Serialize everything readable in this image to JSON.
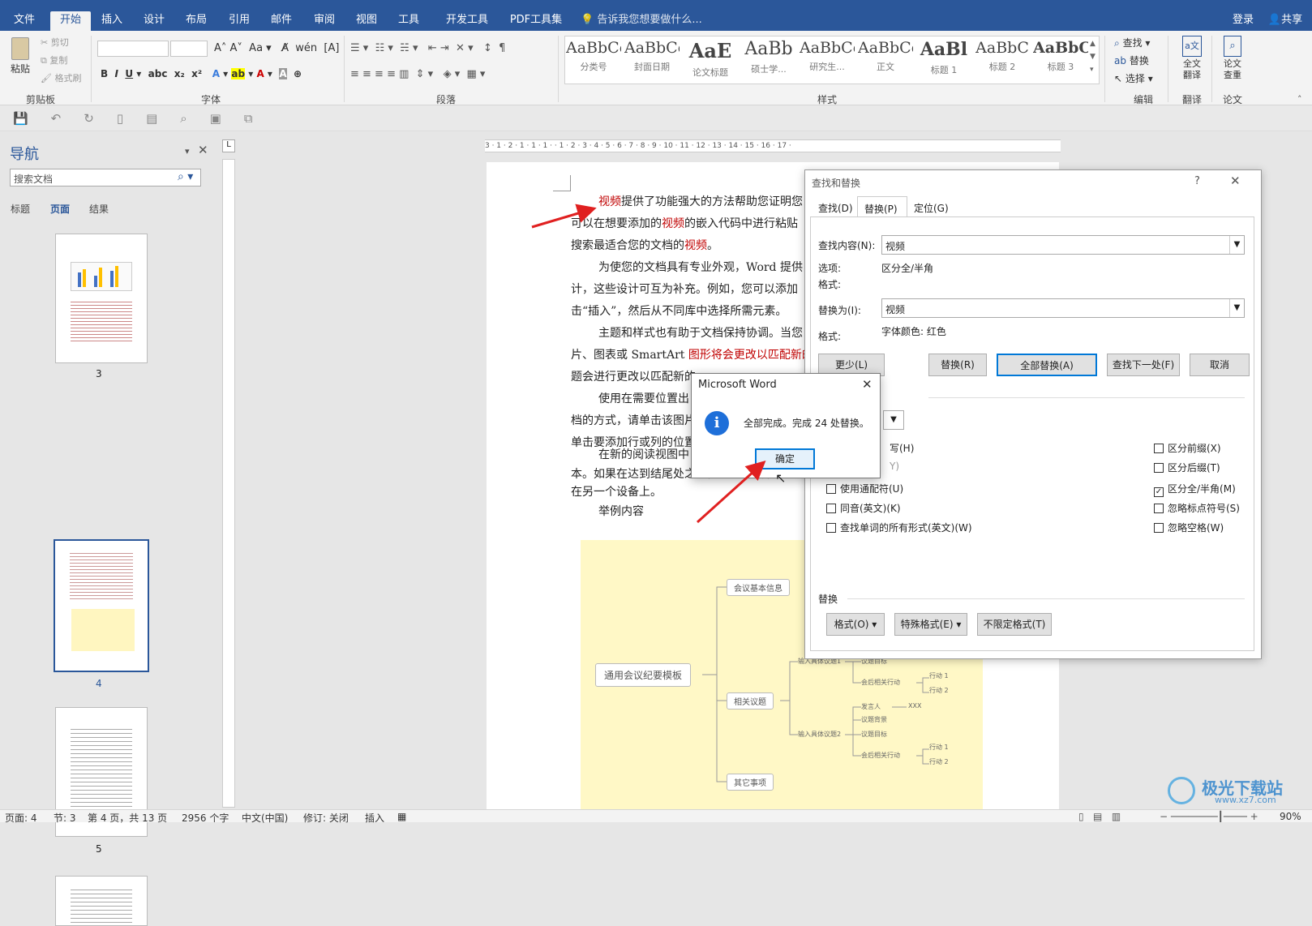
{
  "tabs": {
    "file": "文件",
    "home": "开始",
    "insert": "插入",
    "design": "设计",
    "layout": "布局",
    "references": "引用",
    "mailings": "邮件",
    "review": "审阅",
    "view": "视图",
    "tools": "工具",
    "developer": "开发工具",
    "pdf": "PDF工具集",
    "tellme": "告诉我您想要做什么...",
    "login": "登录",
    "share": "共享"
  },
  "ribbon": {
    "paste": "粘贴",
    "cut": "剪切",
    "copy": "复制",
    "format_painter": "格式刷",
    "clipboard": "剪贴板",
    "font": "字体",
    "paragraph": "段落",
    "styles": "样式",
    "find": "查找",
    "replace": "替换",
    "select": "选择",
    "editing": "编辑",
    "full_translate": "全文\n翻译",
    "translate": "翻译",
    "paper_check": "论文\n查重",
    "paper": "论文",
    "style_items": [
      {
        "preview": "AaBbCc",
        "name": "分类号"
      },
      {
        "preview": "AaBbCc",
        "name": "封面日期"
      },
      {
        "preview": "AaE",
        "name": "论文标题"
      },
      {
        "preview": "AaBb",
        "name": "硕士学..."
      },
      {
        "preview": "AaBbCc",
        "name": "研究生..."
      },
      {
        "preview": "AaBbCcI",
        "name": "正文"
      },
      {
        "preview": "AaBl",
        "name": "标题 1"
      },
      {
        "preview": "AaBbC",
        "name": "标题 2"
      },
      {
        "preview": "AaBbC",
        "name": "标题 3"
      }
    ]
  },
  "nav": {
    "title": "导航",
    "search_placeholder": "搜索文档",
    "tab_headings": "标题",
    "tab_pages": "页面",
    "tab_results": "结果",
    "pages": [
      "3",
      "4",
      "5"
    ]
  },
  "ruler": "3 · 1 · 2 · 1 · 1 · 1 ·      · 1 · 2 · 3 · 4 · 5 · 6 · 7 · 8 · 9 · 10 · 11 · 12 · 13 · 14 · 15 · 16 · 17 · ",
  "doc": {
    "p1": {
      "a": "视频",
      "b": "提供了功能强大的方法帮助您证明您"
    },
    "p2": {
      "a": "可以在想要添加的",
      "b": "视频",
      "c": "的嵌入代码中进行粘贴"
    },
    "p3": {
      "a": "搜索最适合您的文档的",
      "b": "视频",
      "c": "。"
    },
    "p4": "为使您的文档具有专业外观，Word 提供",
    "p5": "计，这些设计可互为补充。例如，您可以添加",
    "p6": "击“插入”，然后从不同库中选择所需元素。",
    "p7": "主题和样式也有助于文档保持协调。当您",
    "p8": {
      "a": "片、图表或 SmartArt ",
      "b": "图形将会更改以匹配新的"
    },
    "p9": "题会进行更改以匹配新的",
    "p10": "使用在需要位置出",
    "p11": "档的方式，请单击该图片",
    "p12": "单击要添加行或列的位置",
    "p13": "在新的阅读视图中",
    "p14": "本。如果在达到结尾处之前需要停止读取，Wo",
    "p15": "在另一个设备上。",
    "p16": "举例内容"
  },
  "diagram": {
    "root": "通用会议纪要模板",
    "n1": "会议基本信息",
    "n2": "相关议题",
    "n3": "其它事项",
    "t1": "输入具体议题1",
    "t2": "输入具体议题2",
    "goal": "议题目标",
    "followup": "会后相关行动",
    "action1": "行动 1",
    "action2": "行动 2",
    "speaker": "发言人",
    "xxx": "XXX",
    "bg": "议题背景"
  },
  "findreplace": {
    "title": "查找和替换",
    "help": "?",
    "tab_find": "查找(D)",
    "tab_replace": "替换(P)",
    "tab_goto": "定位(G)",
    "find_label": "查找内容(N):",
    "find_value": "视频",
    "options_label": "选项:",
    "options_value": "区分全/半角",
    "format_label": "格式:",
    "replace_label": "替换为(I):",
    "replace_value": "视频",
    "format2_label": "格式:",
    "format2_value": "字体颜色: 红色",
    "btn_less": "更少(L)",
    "btn_replace": "替换(R)",
    "btn_replace_all": "全部替换(A)",
    "btn_find_next": "查找下一处(F)",
    "btn_cancel": "取消",
    "opt_match_whole": "全字匹配(Y)",
    "opt_case": "区分大小写(H)",
    "opt_wildcard": "使用通配符(U)",
    "opt_soundslike": "同音(英文)(K)",
    "opt_allforms": "查找单词的所有形式(英文)(W)",
    "opt_prefix": "区分前缀(X)",
    "opt_suffix": "区分后缀(T)",
    "opt_fullhalf": "区分全/半角(M)",
    "opt_punct": "忽略标点符号(S)",
    "opt_space": "忽略空格(W)",
    "frag_h": "写(H)",
    "frag_y": "Y)",
    "replace_section": "替换",
    "btn_format": "格式(O) ▾",
    "btn_special": "特殊格式(E) ▾",
    "btn_noformat": "不限定格式(T)"
  },
  "msgbox": {
    "title": "Microsoft Word",
    "message": "全部完成。完成 24 处替换。",
    "ok": "确定"
  },
  "status": {
    "page": "页面: 4",
    "section": "节: 3",
    "pageof": "第 4 页，共 13 页",
    "words": "2956 个字",
    "lang": "中文(中国)",
    "track": "修订: 关闭",
    "insert": "插入",
    "zoom": "90%"
  },
  "watermark": "极光下载站",
  "watermark_url": "www.xz7.com"
}
